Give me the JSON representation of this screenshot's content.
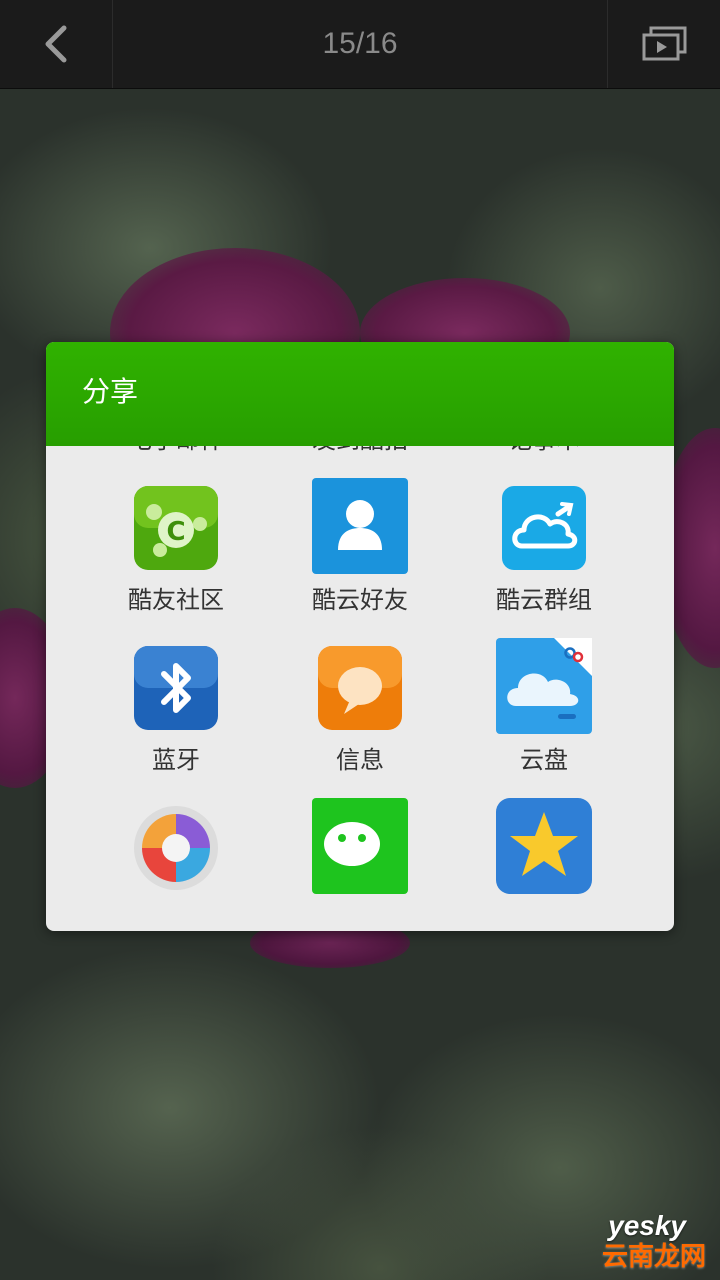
{
  "top_bar": {
    "counter": "15/16"
  },
  "dialog": {
    "title": "分享",
    "items": [
      {
        "label": "电子邮件",
        "icon": "email-icon"
      },
      {
        "label": "发到酷拍",
        "icon": "coolpad-icon"
      },
      {
        "label": "记事本",
        "icon": "notepad-icon"
      },
      {
        "label": "酷友社区",
        "icon": "kuyou-community-icon"
      },
      {
        "label": "酷云好友",
        "icon": "contact-person-icon"
      },
      {
        "label": "酷云群组",
        "icon": "cloud-group-icon"
      },
      {
        "label": "蓝牙",
        "icon": "bluetooth-icon"
      },
      {
        "label": "信息",
        "icon": "message-icon"
      },
      {
        "label": "云盘",
        "icon": "cloud-disk-icon"
      },
      {
        "label": "",
        "icon": "camera-aperture-icon"
      },
      {
        "label": "",
        "icon": "wechat-icon"
      },
      {
        "label": "",
        "icon": "star-favorite-icon"
      }
    ]
  },
  "watermark": {
    "line1": "yesky",
    "line2": "云南龙网"
  },
  "colors": {
    "header_green": "#2ea800",
    "dialog_body": "#ebebeb",
    "top_bar": "#1b1b1b"
  }
}
